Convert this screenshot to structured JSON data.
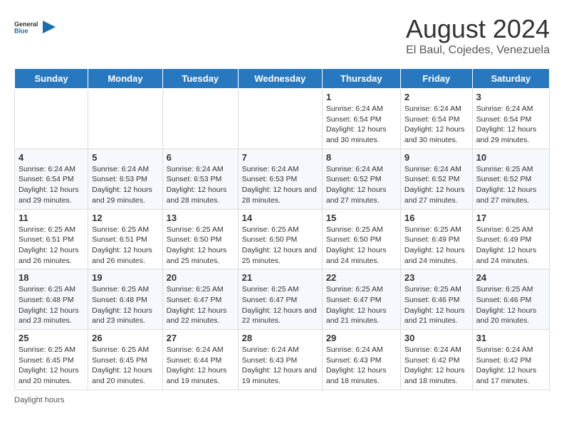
{
  "header": {
    "logo_general": "General",
    "logo_blue": "Blue",
    "title": "August 2024",
    "subtitle": "El Baul, Cojedes, Venezuela"
  },
  "calendar": {
    "weekdays": [
      "Sunday",
      "Monday",
      "Tuesday",
      "Wednesday",
      "Thursday",
      "Friday",
      "Saturday"
    ],
    "weeks": [
      [
        {
          "day": "",
          "info": ""
        },
        {
          "day": "",
          "info": ""
        },
        {
          "day": "",
          "info": ""
        },
        {
          "day": "",
          "info": ""
        },
        {
          "day": "1",
          "info": "Sunrise: 6:24 AM\nSunset: 6:54 PM\nDaylight: 12 hours and 30 minutes."
        },
        {
          "day": "2",
          "info": "Sunrise: 6:24 AM\nSunset: 6:54 PM\nDaylight: 12 hours and 30 minutes."
        },
        {
          "day": "3",
          "info": "Sunrise: 6:24 AM\nSunset: 6:54 PM\nDaylight: 12 hours and 29 minutes."
        }
      ],
      [
        {
          "day": "4",
          "info": "Sunrise: 6:24 AM\nSunset: 6:54 PM\nDaylight: 12 hours and 29 minutes."
        },
        {
          "day": "5",
          "info": "Sunrise: 6:24 AM\nSunset: 6:53 PM\nDaylight: 12 hours and 29 minutes."
        },
        {
          "day": "6",
          "info": "Sunrise: 6:24 AM\nSunset: 6:53 PM\nDaylight: 12 hours and 28 minutes."
        },
        {
          "day": "7",
          "info": "Sunrise: 6:24 AM\nSunset: 6:53 PM\nDaylight: 12 hours and 28 minutes."
        },
        {
          "day": "8",
          "info": "Sunrise: 6:24 AM\nSunset: 6:52 PM\nDaylight: 12 hours and 27 minutes."
        },
        {
          "day": "9",
          "info": "Sunrise: 6:24 AM\nSunset: 6:52 PM\nDaylight: 12 hours and 27 minutes."
        },
        {
          "day": "10",
          "info": "Sunrise: 6:25 AM\nSunset: 6:52 PM\nDaylight: 12 hours and 27 minutes."
        }
      ],
      [
        {
          "day": "11",
          "info": "Sunrise: 6:25 AM\nSunset: 6:51 PM\nDaylight: 12 hours and 26 minutes."
        },
        {
          "day": "12",
          "info": "Sunrise: 6:25 AM\nSunset: 6:51 PM\nDaylight: 12 hours and 26 minutes."
        },
        {
          "day": "13",
          "info": "Sunrise: 6:25 AM\nSunset: 6:50 PM\nDaylight: 12 hours and 25 minutes."
        },
        {
          "day": "14",
          "info": "Sunrise: 6:25 AM\nSunset: 6:50 PM\nDaylight: 12 hours and 25 minutes."
        },
        {
          "day": "15",
          "info": "Sunrise: 6:25 AM\nSunset: 6:50 PM\nDaylight: 12 hours and 24 minutes."
        },
        {
          "day": "16",
          "info": "Sunrise: 6:25 AM\nSunset: 6:49 PM\nDaylight: 12 hours and 24 minutes."
        },
        {
          "day": "17",
          "info": "Sunrise: 6:25 AM\nSunset: 6:49 PM\nDaylight: 12 hours and 24 minutes."
        }
      ],
      [
        {
          "day": "18",
          "info": "Sunrise: 6:25 AM\nSunset: 6:48 PM\nDaylight: 12 hours and 23 minutes."
        },
        {
          "day": "19",
          "info": "Sunrise: 6:25 AM\nSunset: 6:48 PM\nDaylight: 12 hours and 23 minutes."
        },
        {
          "day": "20",
          "info": "Sunrise: 6:25 AM\nSunset: 6:47 PM\nDaylight: 12 hours and 22 minutes."
        },
        {
          "day": "21",
          "info": "Sunrise: 6:25 AM\nSunset: 6:47 PM\nDaylight: 12 hours and 22 minutes."
        },
        {
          "day": "22",
          "info": "Sunrise: 6:25 AM\nSunset: 6:47 PM\nDaylight: 12 hours and 21 minutes."
        },
        {
          "day": "23",
          "info": "Sunrise: 6:25 AM\nSunset: 6:46 PM\nDaylight: 12 hours and 21 minutes."
        },
        {
          "day": "24",
          "info": "Sunrise: 6:25 AM\nSunset: 6:46 PM\nDaylight: 12 hours and 20 minutes."
        }
      ],
      [
        {
          "day": "25",
          "info": "Sunrise: 6:25 AM\nSunset: 6:45 PM\nDaylight: 12 hours and 20 minutes."
        },
        {
          "day": "26",
          "info": "Sunrise: 6:25 AM\nSunset: 6:45 PM\nDaylight: 12 hours and 20 minutes."
        },
        {
          "day": "27",
          "info": "Sunrise: 6:24 AM\nSunset: 6:44 PM\nDaylight: 12 hours and 19 minutes."
        },
        {
          "day": "28",
          "info": "Sunrise: 6:24 AM\nSunset: 6:43 PM\nDaylight: 12 hours and 19 minutes."
        },
        {
          "day": "29",
          "info": "Sunrise: 6:24 AM\nSunset: 6:43 PM\nDaylight: 12 hours and 18 minutes."
        },
        {
          "day": "30",
          "info": "Sunrise: 6:24 AM\nSunset: 6:42 PM\nDaylight: 12 hours and 18 minutes."
        },
        {
          "day": "31",
          "info": "Sunrise: 6:24 AM\nSunset: 6:42 PM\nDaylight: 12 hours and 17 minutes."
        }
      ]
    ]
  },
  "footer": {
    "note": "Daylight hours"
  }
}
